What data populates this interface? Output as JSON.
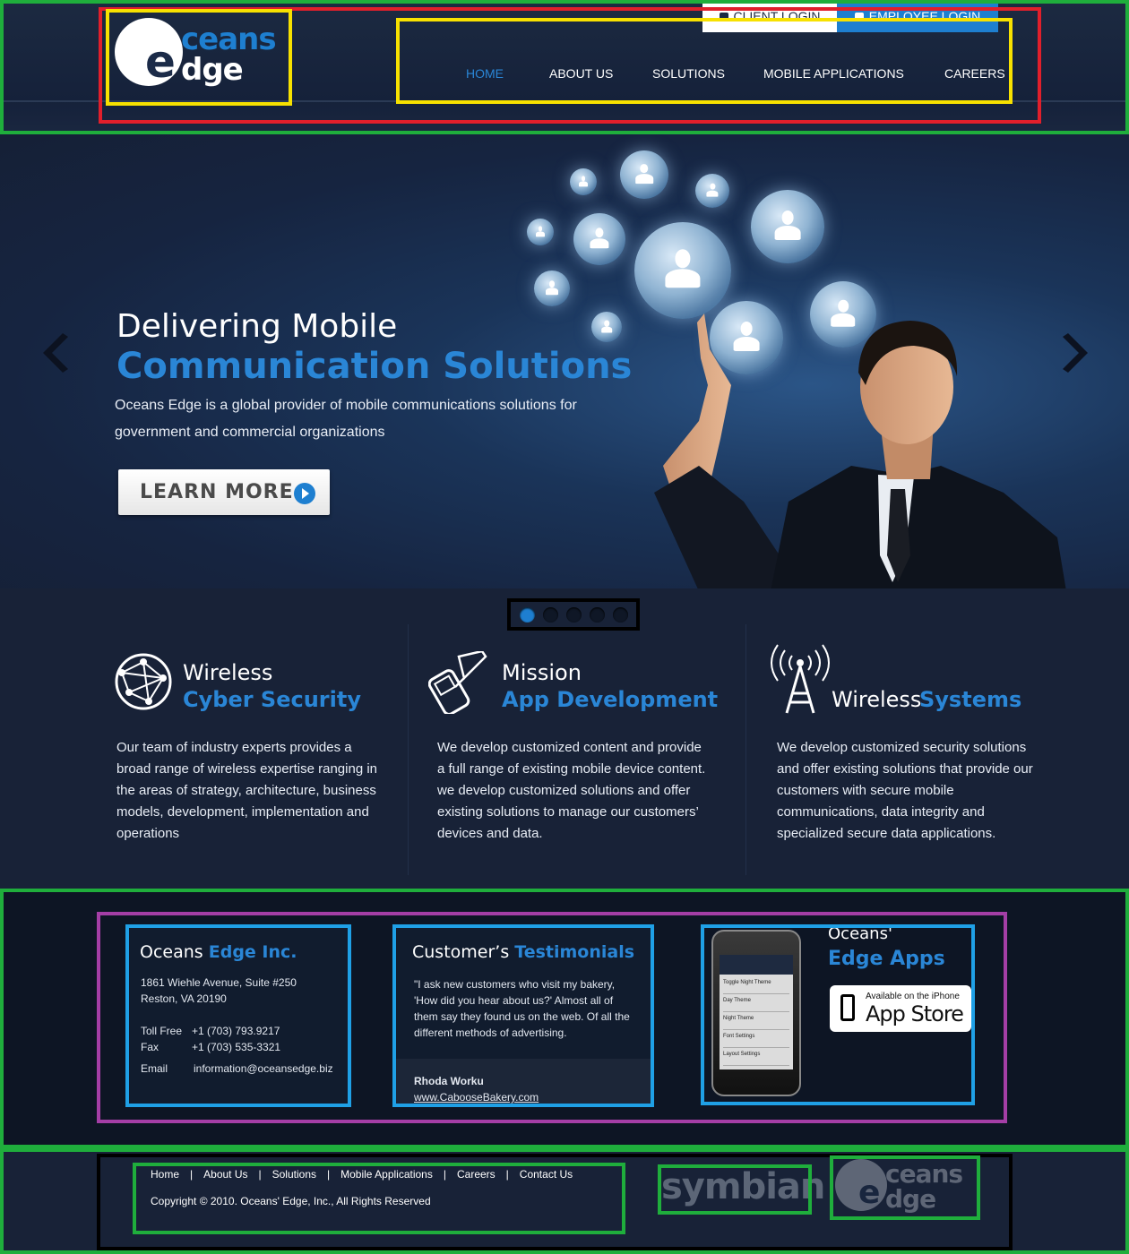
{
  "header": {
    "client_login": "CLIENT LOGIN",
    "employee_login": "EMPLOYEE LOGIN",
    "logo": {
      "line1": "ceans",
      "line2": "dge",
      "letter": "e"
    },
    "nav": [
      "HOME",
      "ABOUT US",
      "SOLUTIONS",
      "MOBILE APPLICATIONS",
      "CAREERS"
    ],
    "active_nav": "HOME"
  },
  "hero": {
    "title_line1": "Delivering Mobile",
    "title_line2": "Communication Solutions",
    "description": "Oceans Edge is a global provider of mobile communications solutions for government and commercial organizations",
    "button": "LEARN MORE",
    "slides": 5,
    "active_slide": 1
  },
  "features": [
    {
      "title_plain": "Wireless",
      "title_highlight": "Cyber Security",
      "icon": "globe-network-icon",
      "text": "Our team of industry experts provides a broad range of wireless expertise ranging in the areas of strategy, architecture, business models, development, implementation and operations"
    },
    {
      "title_plain": "Mission",
      "title_highlight": "App Development",
      "icon": "mobile-phone-icon",
      "text": "We develop customized content and provide a full range of existing mobile device content. we develop customized solutions and offer existing solutions to manage our customers’ devices and data."
    },
    {
      "title_plain": "Wireless",
      "title_highlight": "Systems",
      "icon": "radio-tower-icon",
      "text": "We develop customized security solutions and offer existing solutions that provide our customers with secure mobile communications, data integrity and specialized secure data applications."
    }
  ],
  "contact": {
    "title_plain": "Oceans",
    "title_highlight": "Edge Inc.",
    "address1": "1861 Wiehle Avenue, Suite #250",
    "address2": "Reston, VA 20190",
    "tollfree_label": "Toll Free",
    "tollfree": "+1  (703) 793.9217",
    "fax_label": "Fax",
    "fax": "+1 (703) 535-3321",
    "email_label": "Email",
    "email": "information@oceansedge.biz"
  },
  "testimonial": {
    "title_plain": "Customer’s",
    "title_highlight": "Testimonials",
    "quote": "\"I ask new customers who visit my bakery, 'How did you hear about us?' Almost all of them say they found us on the web. Of all the different methods of advertising.",
    "author": "Rhoda Worku",
    "site": "www.CabooseBakery.com"
  },
  "apps": {
    "title_plain": "Oceans'",
    "title_highlight": "Edge Apps",
    "store_line1": "Available on the iPhone",
    "store_line2": "App Store",
    "phone_rows": [
      "Toggle Night Theme",
      "Day Theme",
      "Night Theme",
      "Font Settings",
      "Layout Settings"
    ]
  },
  "footer": {
    "links": [
      "Home",
      "About Us",
      "Solutions",
      "Mobile Applications",
      "Careers",
      "Contact Us"
    ],
    "copyright": "Copyright © 2010. Oceans' Edge, Inc., All Rights Reserved",
    "partner": "symbian"
  },
  "colors": {
    "accent": "#2a86d6",
    "background": "#182237",
    "footer": "#0d1524"
  }
}
